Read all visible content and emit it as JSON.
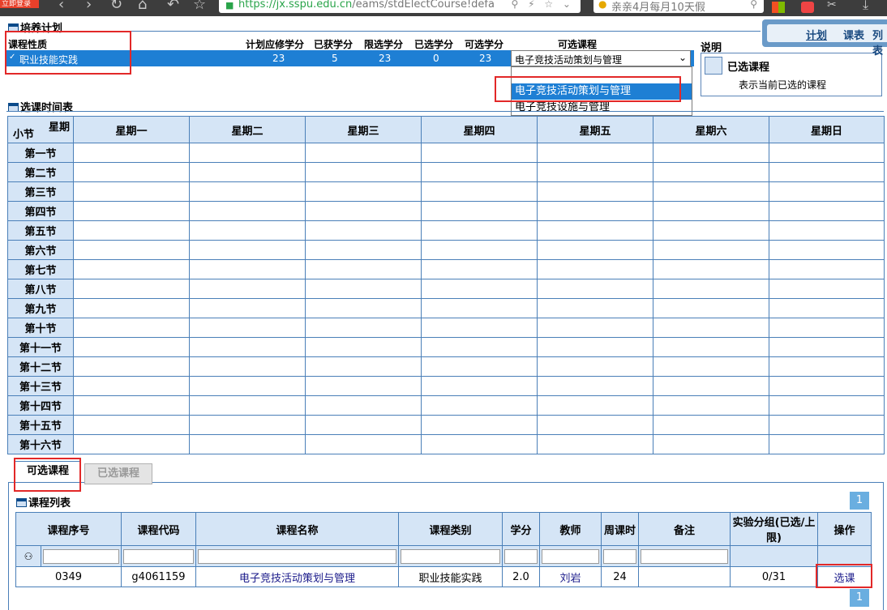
{
  "browser": {
    "login_badge": "立即登录",
    "url_host": "https://jx.sspu.edu.cn",
    "url_path": "/eams/stdElectCourse!defa",
    "search_text": "亲亲4月每月10天假"
  },
  "plan": {
    "section_title": "培养计划",
    "headers": {
      "course_nature": "课程性质",
      "required_credits": "计划应修学分",
      "earned_credits": "已获学分",
      "limit_credits": "限选学分",
      "selected_credits": "已选学分",
      "available_credits": "可选学分",
      "available_courses": "可选课程"
    },
    "row": {
      "course_nature": "职业技能实践",
      "required_credits": "23",
      "earned_credits": "5",
      "limit_credits": "23",
      "selected_credits": "0",
      "available_credits": "23"
    },
    "select_value": "电子竞技活动策划与管理",
    "dropdown_options": [
      "",
      "电子竞技活动策划与管理",
      "电子竞技设施与管理"
    ]
  },
  "legend": {
    "title": "说明",
    "item_label": "已选课程",
    "item_desc": "表示当前已选的课程"
  },
  "top_tabs": [
    "计划",
    "课表",
    "列表"
  ],
  "timetable": {
    "section_title": "选课时间表",
    "corner_week": "星期",
    "corner_period": "小节",
    "days": [
      "星期一",
      "星期二",
      "星期三",
      "星期四",
      "星期五",
      "星期六",
      "星期日"
    ],
    "periods": [
      "第一节",
      "第二节",
      "第三节",
      "第四节",
      "第五节",
      "第六节",
      "第七节",
      "第八节",
      "第九节",
      "第十节",
      "第十一节",
      "第十二节",
      "第十三节",
      "第十四节",
      "第十五节",
      "第十六节"
    ]
  },
  "tabs": {
    "available": "可选课程",
    "selected": "已选课程"
  },
  "course_list": {
    "section_title": "课程列表",
    "page_top": "1",
    "page_bottom": "1",
    "columns": [
      "课程序号",
      "课程代码",
      "课程名称",
      "课程类别",
      "学分",
      "教师",
      "周课时",
      "备注",
      "实验分组(已选/上限)",
      "操作"
    ],
    "rows": [
      {
        "seq": "0349",
        "code": "g4061159",
        "name": "电子竞技活动策划与管理",
        "category": "职业技能实践",
        "credits": "2.0",
        "teacher": "刘岩",
        "weekly_hours": "24",
        "remark": "",
        "lab_group": "0/31",
        "action": "选课"
      }
    ]
  },
  "colors": {
    "accent": "#1e7fd4",
    "header_bg": "#d5e5f6",
    "border": "#4a7fb8",
    "highlight": "#e22828"
  }
}
